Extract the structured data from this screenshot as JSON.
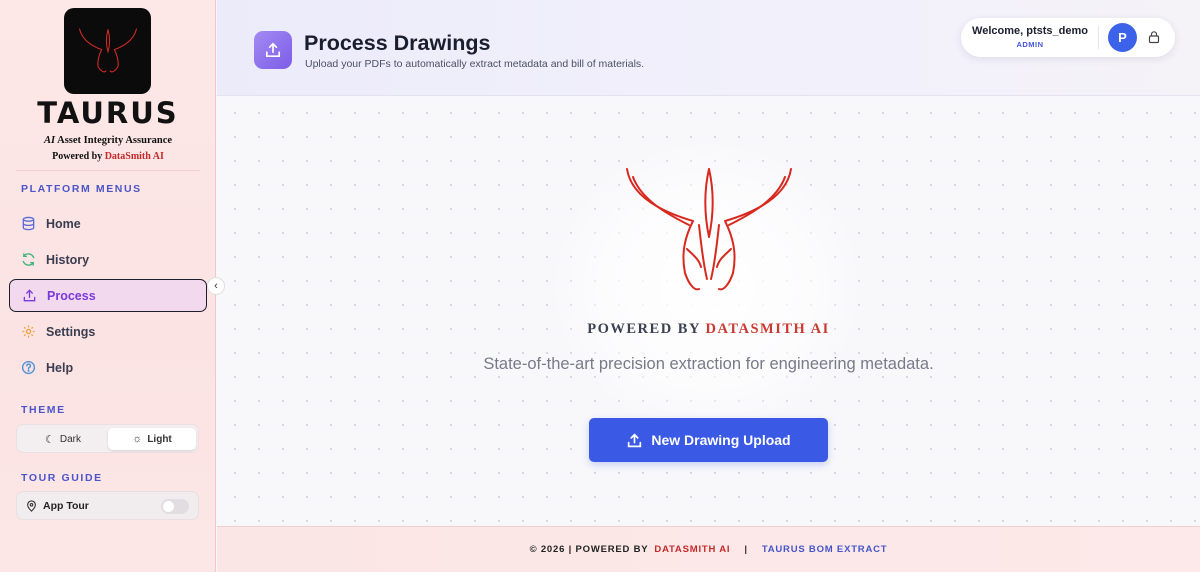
{
  "sidebar": {
    "brand": "TAURUS",
    "tagline_ai": "AI",
    "tagline_rest": " Asset Integrity Assurance",
    "powered_prefix": "Powered by ",
    "powered_name": "DataSmith AI",
    "platform_title": "PLATFORM MENUS",
    "nav": [
      {
        "label": "Home",
        "icon": "database-icon"
      },
      {
        "label": "History",
        "icon": "refresh-icon"
      },
      {
        "label": "Process",
        "icon": "upload-icon",
        "active": true
      },
      {
        "label": "Settings",
        "icon": "gear-icon"
      },
      {
        "label": "Help",
        "icon": "help-icon"
      }
    ],
    "theme_title": "THEME",
    "theme_dark": "Dark",
    "theme_light": "Light",
    "theme_selected": "Light",
    "tour_title": "TOUR GUIDE",
    "tour_label": "App Tour",
    "tour_enabled": false
  },
  "header": {
    "title": "Process Drawings",
    "subtitle": "Upload your PDFs to automatically extract metadata and bill of materials.",
    "welcome": "Welcome, ptsts_demo",
    "role": "ADMIN",
    "avatar_initial": "P"
  },
  "main": {
    "powered_prefix": "POWERED BY ",
    "powered_name": "DATASMITH AI",
    "description": "State-of-the-art precision extraction for engineering metadata.",
    "upload_label": "New Drawing Upload"
  },
  "footer": {
    "copyright": "© 2026 | POWERED BY",
    "company": "DATASMITH AI",
    "separator": "|",
    "product": "TAURUS BOM EXTRACT"
  },
  "colors": {
    "accent": "#3a59e4",
    "brand_red": "#c42a2a",
    "active_purple": "#7a3ad9"
  }
}
